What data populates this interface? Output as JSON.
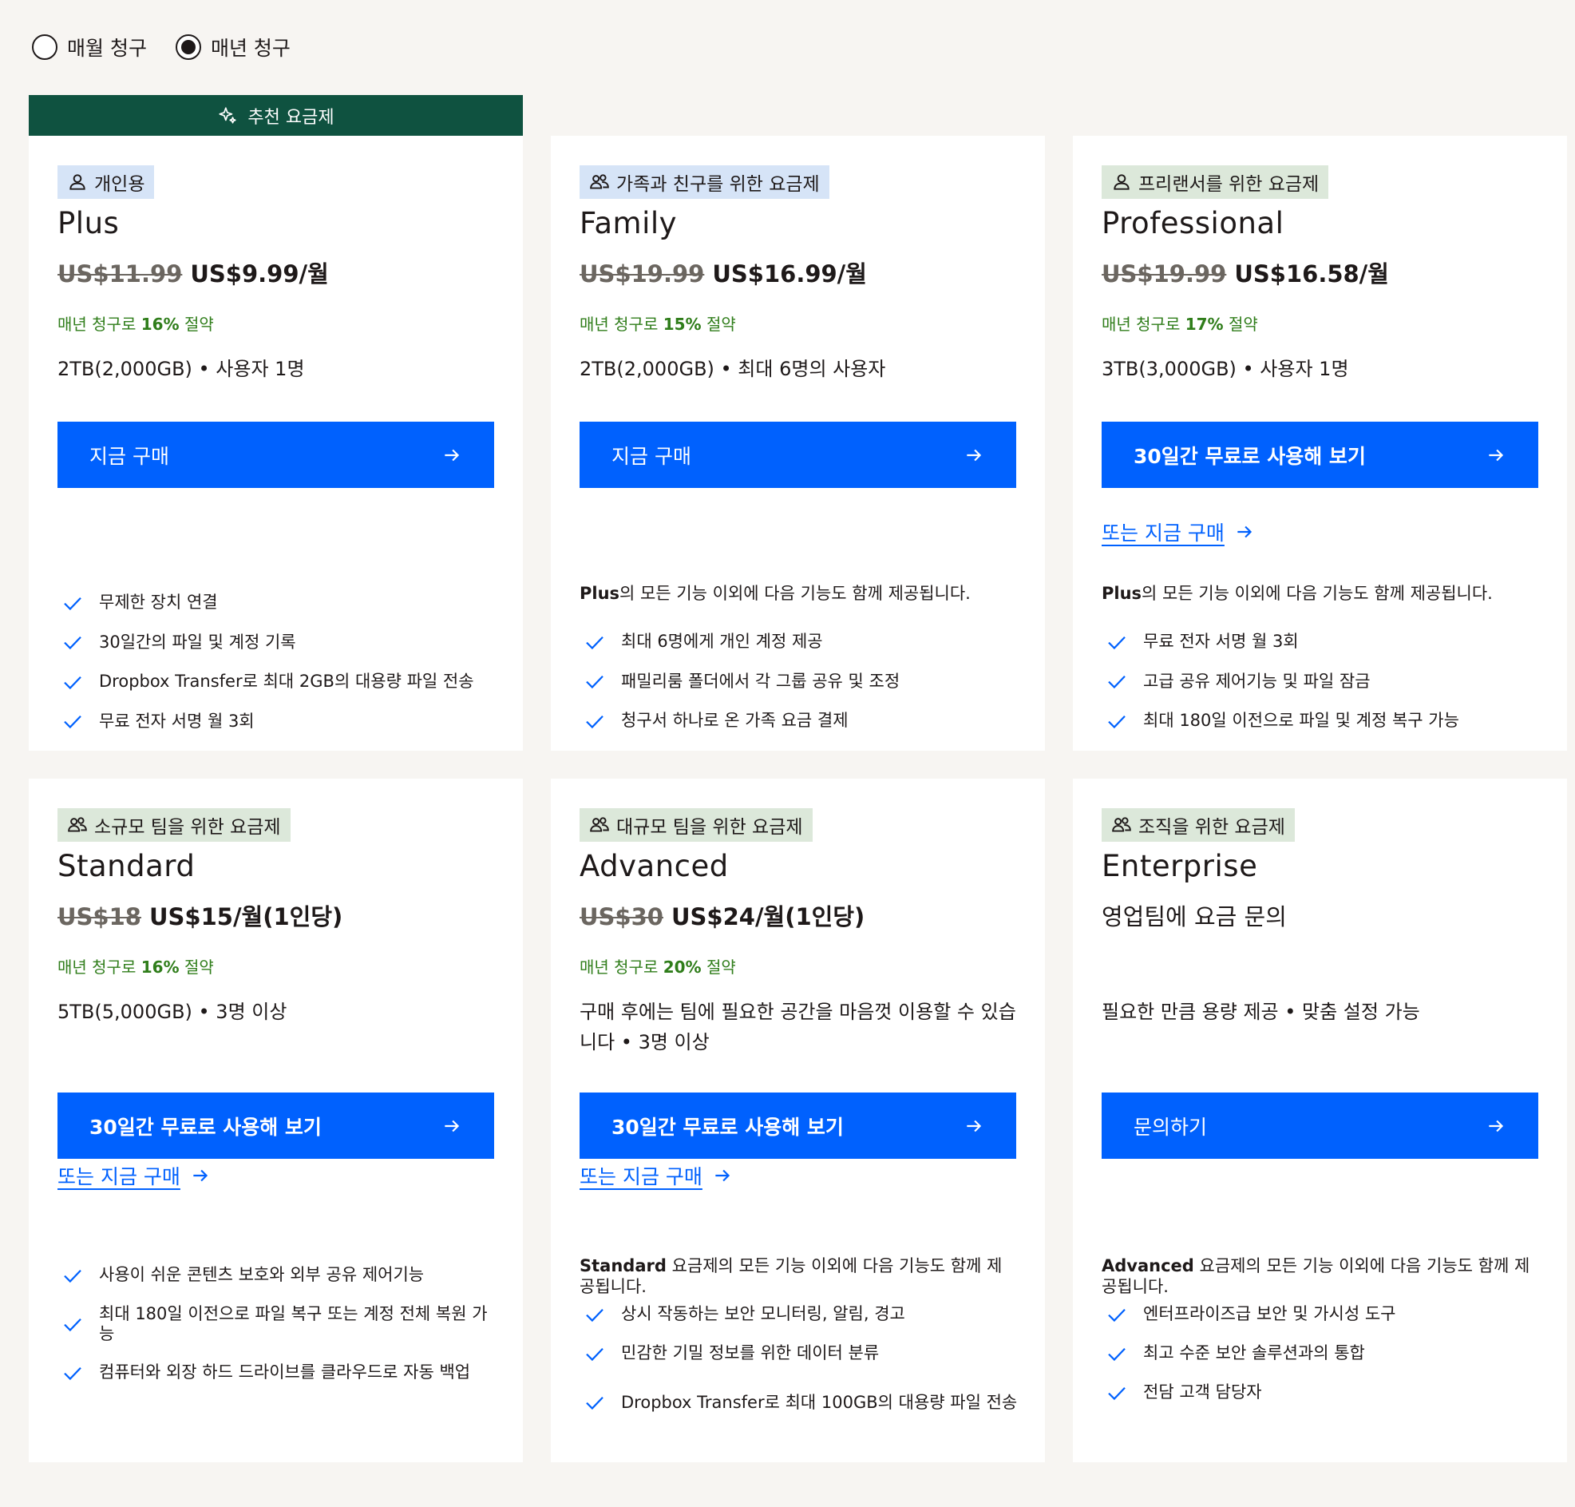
{
  "billing": {
    "monthly_label": "매월 청구",
    "annual_label": "매년 청구",
    "selected": "annual"
  },
  "recommended_banner": "추천 요금제",
  "colors": {
    "accent": "#0061fe",
    "banner": "#0f5240",
    "save_text": "#2f7d1a",
    "tag_blue": "#d6e4f7",
    "tag_green": "#dce8da"
  },
  "plans": [
    {
      "tag": "개인용",
      "tag_icon": "person-icon",
      "name": "Plus",
      "old_price": "US$11.99",
      "price": "US$9.99/월",
      "save_prefix": "매년 청구로 ",
      "save_pct": "16%",
      "save_suffix": " 절약",
      "storage": "2TB(2,000GB) • 사용자 1명",
      "cta": "지금 구매",
      "features": [
        "무제한 장치 연결",
        "30일간의 파일 및 계정 기록",
        "Dropbox Transfer로 최대 2GB의 대용량 파일 전송",
        "무료 전자 서명 월 3회"
      ]
    },
    {
      "tag": "가족과 친구를 위한 요금제",
      "tag_icon": "people-icon",
      "name": "Family",
      "old_price": "US$19.99",
      "price": "US$16.99/월",
      "save_prefix": "매년 청구로 ",
      "save_pct": "15%",
      "save_suffix": " 절약",
      "storage": "2TB(2,000GB) • 최대 6명의 사용자",
      "cta": "지금 구매",
      "intro_bold": "Plus",
      "intro_rest": "의 모든 기능 이외에 다음 기능도 함께 제공됩니다.",
      "features": [
        "최대 6명에게 개인 계정 제공",
        "패밀리룸 폴더에서 각 그룹 공유 및 조정",
        "청구서 하나로 온 가족 요금 결제"
      ]
    },
    {
      "tag": "프리랜서를 위한 요금제",
      "tag_icon": "person-icon",
      "name": "Professional",
      "old_price": "US$19.99",
      "price": "US$16.58/월",
      "save_prefix": "매년 청구로 ",
      "save_pct": "17%",
      "save_suffix": " 절약",
      "storage": "3TB(3,000GB) • 사용자 1명",
      "cta": "30일간 무료로 사용해 보기",
      "link": "또는 지금 구매",
      "intro_bold": "Plus",
      "intro_rest": "의 모든 기능 이외에 다음 기능도 함께 제공됩니다.",
      "features": [
        "무료 전자 서명 월 3회",
        "고급 공유 제어기능 및 파일 잠금",
        "최대 180일 이전으로 파일 및 계정 복구 가능"
      ]
    },
    {
      "tag": "소규모 팀을 위한 요금제",
      "tag_icon": "people-icon",
      "name": "Standard",
      "old_price": "US$18",
      "price": "US$15/월(1인당)",
      "save_prefix": "매년 청구로 ",
      "save_pct": "16%",
      "save_suffix": " 절약",
      "storage": "5TB(5,000GB) • 3명 이상",
      "cta": "30일간 무료로 사용해 보기",
      "link": "또는 지금 구매",
      "features": [
        "사용이 쉬운 콘텐츠 보호와 외부 공유 제어기능",
        "최대 180일 이전으로 파일 복구 또는 계정 전체 복원 가능",
        "컴퓨터와 외장 하드 드라이브를 클라우드로 자동 백업"
      ]
    },
    {
      "tag": "대규모 팀을 위한 요금제",
      "tag_icon": "people-icon",
      "name": "Advanced",
      "old_price": "US$30",
      "price": "US$24/월(1인당)",
      "save_prefix": "매년 청구로 ",
      "save_pct": "20%",
      "save_suffix": " 절약",
      "storage": "구매 후에는 팀에 필요한 공간을 마음껏 이용할 수 있습니다 • 3명 이상",
      "cta": "30일간 무료로 사용해 보기",
      "link": "또는 지금 구매",
      "intro_bold": "Standard",
      "intro_rest": " 요금제의 모든 기능 이외에 다음 기능도 함께 제공됩니다.",
      "features": [
        "상시 작동하는 보안 모니터링, 알림, 경고",
        "민감한 기밀 정보를 위한 데이터 분류",
        "Dropbox Transfer로 최대 100GB의 대용량 파일 전송"
      ]
    },
    {
      "tag": "조직을 위한 요금제",
      "tag_icon": "people-icon",
      "name": "Enterprise",
      "price": "영업팀에 요금 문의",
      "storage": "필요한 만큼 용량 제공 • 맞춤 설정 가능",
      "cta": "문의하기",
      "intro_bold": "Advanced",
      "intro_rest": " 요금제의 모든 기능 이외에 다음 기능도 함께 제공됩니다.",
      "features": [
        "엔터프라이즈급 보안 및 가시성 도구",
        "최고 수준 보안 솔루션과의 통합",
        "전담 고객 담당자"
      ]
    }
  ]
}
